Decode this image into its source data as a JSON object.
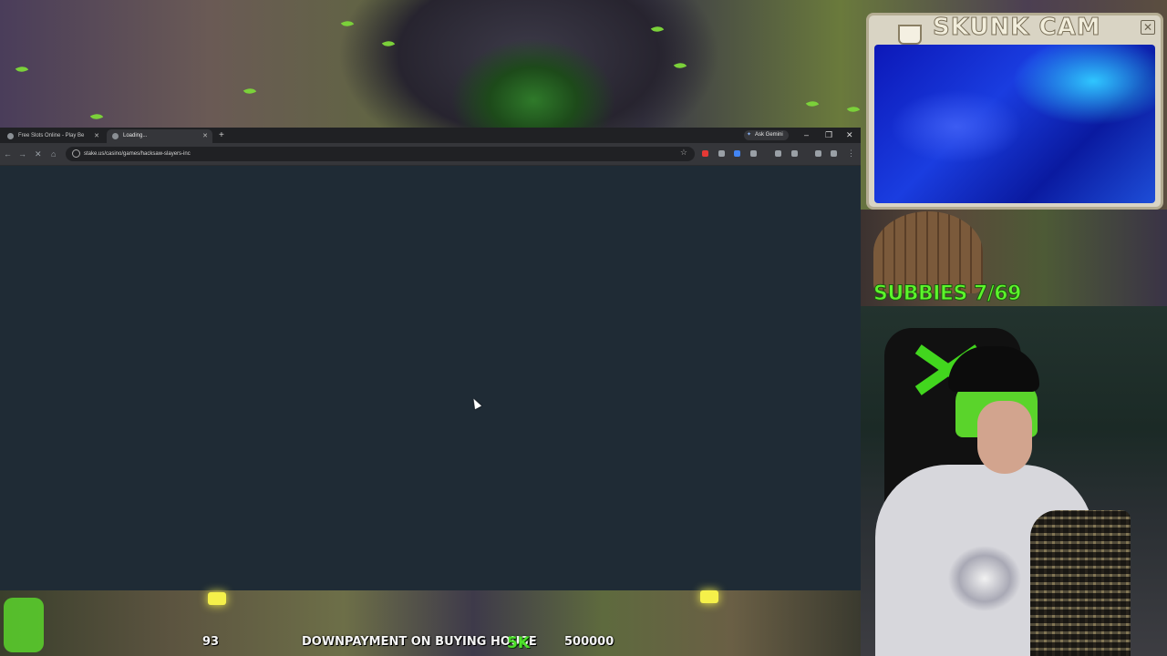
{
  "browser": {
    "tabs": [
      {
        "label": "Free Slots Online - Play Be",
        "active": false
      },
      {
        "label": "Loading...",
        "active": true
      }
    ],
    "new_tab_icon": "plus-icon",
    "gemini_label": "Ask Gemini",
    "url": "stake.us/casino/games/hacksaw-slayers-inc",
    "window_controls": {
      "minimize": "–",
      "restore": "❐",
      "close": "✕"
    }
  },
  "overlay": {
    "cam_title": "SKUNK CAM",
    "subbies_label": "SUBBIES 7/69",
    "bottom": {
      "count": "93",
      "goal_text": "DOWNPAYMENT ON BUYING HOUSE",
      "goal_progress": "5K",
      "goal_target": "500000"
    }
  },
  "colors": {
    "accent_green": "#5cf52b",
    "browser_bg": "#1f2b35"
  }
}
